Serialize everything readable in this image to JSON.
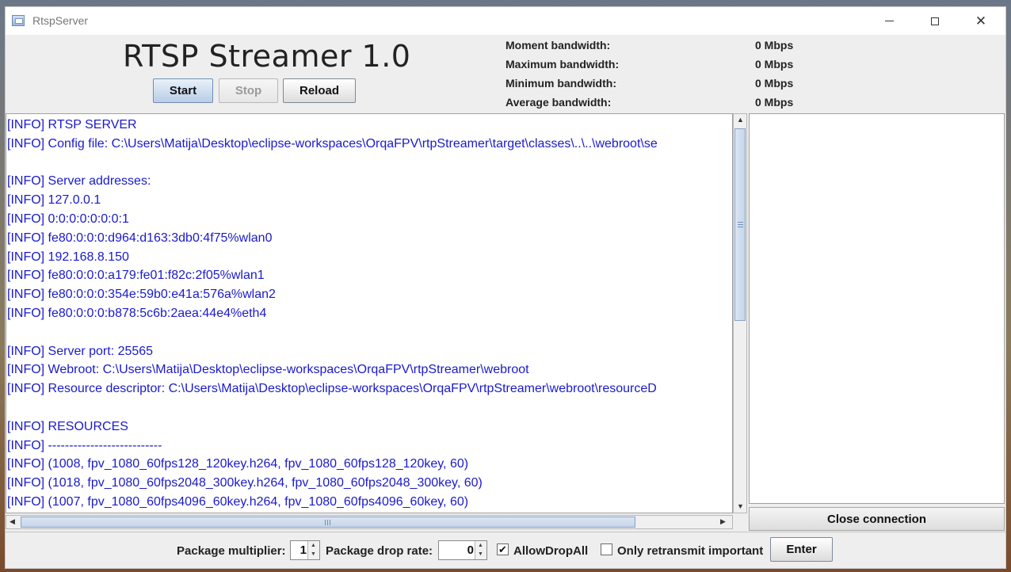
{
  "window": {
    "title": "RtspServer"
  },
  "header": {
    "title": "RTSP Streamer 1.0",
    "buttons": {
      "start": "Start",
      "stop": "Stop",
      "reload": "Reload"
    }
  },
  "bandwidth": [
    {
      "label": "Moment bandwidth:",
      "value": "0 Mbps"
    },
    {
      "label": "Maximum bandwidth:",
      "value": "0 Mbps"
    },
    {
      "label": "Minimum bandwidth:",
      "value": "0 Mbps"
    },
    {
      "label": "Average bandwidth:",
      "value": "0 Mbps"
    }
  ],
  "log": [
    "[INFO] RTSP SERVER",
    "[INFO] Config file: C:\\Users\\Matija\\Desktop\\eclipse-workspaces\\OrqaFPV\\rtpStreamer\\target\\classes\\..\\..\\webroot\\se",
    "",
    "[INFO] Server addresses:",
    "[INFO] 127.0.0.1",
    "[INFO] 0:0:0:0:0:0:0:1",
    "[INFO] fe80:0:0:0:d964:d163:3db0:4f75%wlan0",
    "[INFO] 192.168.8.150",
    "[INFO] fe80:0:0:0:a179:fe01:f82c:2f05%wlan1",
    "[INFO] fe80:0:0:0:354e:59b0:e41a:576a%wlan2",
    "[INFO] fe80:0:0:0:b878:5c6b:2aea:44e4%eth4",
    "",
    "[INFO] Server port: 25565",
    "[INFO] Webroot: C:\\Users\\Matija\\Desktop\\eclipse-workspaces\\OrqaFPV\\rtpStreamer\\webroot",
    "[INFO] Resource descriptor: C:\\Users\\Matija\\Desktop\\eclipse-workspaces\\OrqaFPV\\rtpStreamer\\webroot\\resourceD",
    "",
    "[INFO] RESOURCES",
    "[INFO] ---------------------------",
    "[INFO] (1008, fpv_1080_60fps128_120key.h264, fpv_1080_60fps128_120key, 60)",
    "[INFO] (1018, fpv_1080_60fps2048_300key.h264, fpv_1080_60fps2048_300key, 60)",
    "[INFO] (1007, fpv_1080_60fps4096_60key.h264, fpv_1080_60fps4096_60key, 60)"
  ],
  "connections": {
    "close_label": "Close connection"
  },
  "bottom": {
    "package_multiplier_label": "Package multiplier:",
    "package_multiplier_value": "1",
    "package_drop_rate_label": "Package drop rate:",
    "package_drop_rate_value": "0",
    "allow_drop_all_label": "AllowDropAll",
    "allow_drop_all_checked": true,
    "only_retransmit_label": "Only retransmit important",
    "only_retransmit_checked": false,
    "enter_label": "Enter"
  },
  "icons": {
    "app": "app-window-icon",
    "minimize": "minimize-icon",
    "maximize": "maximize-icon",
    "close": "close-icon"
  }
}
